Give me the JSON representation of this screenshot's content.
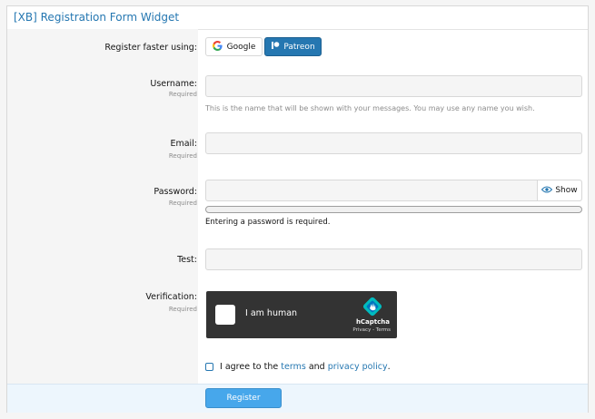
{
  "widget": {
    "title": "[XB] Registration Form Widget"
  },
  "social": {
    "label": "Register faster using:",
    "google_label": "Google",
    "patreon_label": "Patreon"
  },
  "username": {
    "label": "Username:",
    "hint": "Required",
    "value": "",
    "explain": "This is the name that will be shown with your messages. You may use any name you wish."
  },
  "email": {
    "label": "Email:",
    "hint": "Required",
    "value": ""
  },
  "password": {
    "label": "Password:",
    "hint": "Required",
    "value": "",
    "show_label": "Show",
    "strength_fraction": 0,
    "strength_text": "Entering a password is required."
  },
  "test": {
    "label": "Test:",
    "value": ""
  },
  "verification": {
    "label": "Verification:",
    "hint": "Required",
    "captcha_text": "I am human",
    "captcha_brand": "hCaptcha",
    "captcha_links": "Privacy - Terms"
  },
  "agree": {
    "prefix": "I agree to the",
    "terms": "terms",
    "and": "and",
    "privacy": "privacy policy",
    "suffix": "."
  },
  "footer": {
    "register_label": "Register"
  },
  "colors": {
    "accent": "#2577b1",
    "register_button": "#47a7eb",
    "footer_bg": "#edf6fd"
  }
}
